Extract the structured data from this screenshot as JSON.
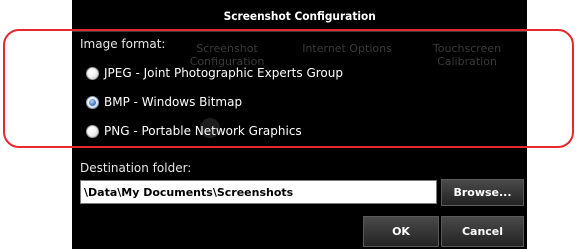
{
  "dialog": {
    "title": "Screenshot Configuration"
  },
  "background_items": [
    {
      "label": "Screenshot\nConfiguration"
    },
    {
      "label": "Internet Options"
    },
    {
      "label": "Touchscreen\nCalibration"
    }
  ],
  "image_format": {
    "label": "Image format:",
    "options": [
      {
        "label": "JPEG - Joint Photographic Experts Group",
        "selected": false
      },
      {
        "label": "BMP - Windows Bitmap",
        "selected": true
      },
      {
        "label": "PNG - Portable Network Graphics",
        "selected": false
      }
    ]
  },
  "destination": {
    "label": "Destination folder:",
    "value": "\\Data\\My Documents\\Screenshots",
    "browse_label": "Browse..."
  },
  "buttons": {
    "ok_label": "OK",
    "cancel_label": "Cancel"
  },
  "colors": {
    "highlight": "#e8282e",
    "dialog_bg": "#000000",
    "radio_selected": "#4f82c8"
  }
}
